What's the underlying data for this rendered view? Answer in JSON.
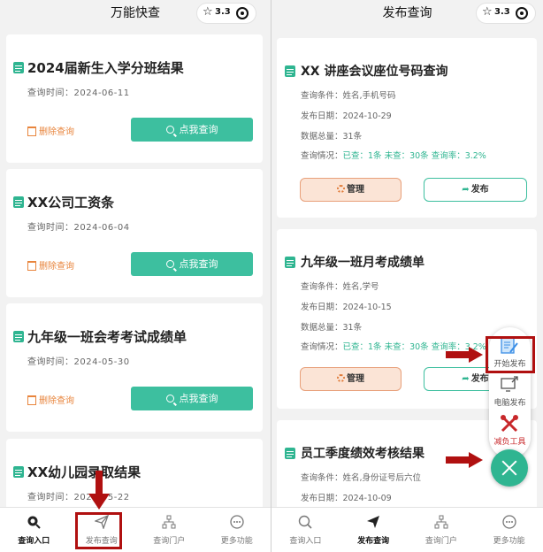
{
  "left": {
    "title": "万能快查",
    "capsule": {
      "star": "☆",
      "rating": "3.3"
    },
    "cards": [
      {
        "title": "2024届新生入学分班结果",
        "date": "查询时间：2024-06-11",
        "delete": "删除查询",
        "query": "点我查询"
      },
      {
        "title": "XX公司工资条",
        "date": "查询时间：2024-06-04",
        "delete": "删除查询",
        "query": "点我查询"
      },
      {
        "title": "九年级一班会考考试成绩单",
        "date": "查询时间：2024-05-30",
        "delete": "删除查询",
        "query": "点我查询"
      },
      {
        "title": "XX幼儿园录取结果",
        "date": "查询时间：2024-05-22"
      }
    ],
    "tabs": [
      {
        "label": "查询入口",
        "icon": "search-icon",
        "active": true
      },
      {
        "label": "发布查询",
        "icon": "send-icon",
        "active": false
      },
      {
        "label": "查询门户",
        "icon": "sitemap-icon",
        "active": false
      },
      {
        "label": "更多功能",
        "icon": "more-icon",
        "active": false
      }
    ]
  },
  "right": {
    "title": "发布查询",
    "capsule": {
      "star": "☆",
      "rating": "3.3"
    },
    "cards": [
      {
        "title": "XX 讲座会议座位号码查询",
        "conditions": "查询条件：姓名,手机号码",
        "publish_date": "发布日期：2024-10-29",
        "total": "数据总量：31条",
        "status_prefix": "查询情况：",
        "status_value": "已查：1条 未查：30条 查询率：3.2%",
        "manage": "管理",
        "publish": "发布"
      },
      {
        "title": "九年级一班月考成绩单",
        "conditions": "查询条件：姓名,学号",
        "publish_date": "发布日期：2024-10-15",
        "total": "数据总量：31条",
        "status_prefix": "查询情况：",
        "status_value": "已查：1条 未查：30条 查询率：3.2%",
        "manage": "管理",
        "publish": "发布"
      },
      {
        "title": "员工季度绩效考核结果",
        "conditions": "查询条件：姓名,身份证号后六位",
        "publish_date": "发布日期：2024-10-09"
      }
    ],
    "fab_menu": [
      {
        "label": "开始发布",
        "icon": "edit-document-icon"
      },
      {
        "label": "电脑发布",
        "icon": "computer-upload-icon"
      },
      {
        "label": "减负工具",
        "icon": "tools-icon"
      }
    ],
    "tabs": [
      {
        "label": "查询入口",
        "icon": "search-icon",
        "active": false
      },
      {
        "label": "发布查询",
        "icon": "send-icon",
        "active": true
      },
      {
        "label": "查询门户",
        "icon": "sitemap-icon",
        "active": false
      },
      {
        "label": "更多功能",
        "icon": "more-icon",
        "active": false
      }
    ]
  },
  "colors": {
    "accent": "#2fb591",
    "button": "#3dbf9f",
    "warning": "#e8853d",
    "highlight": "#b01010"
  }
}
